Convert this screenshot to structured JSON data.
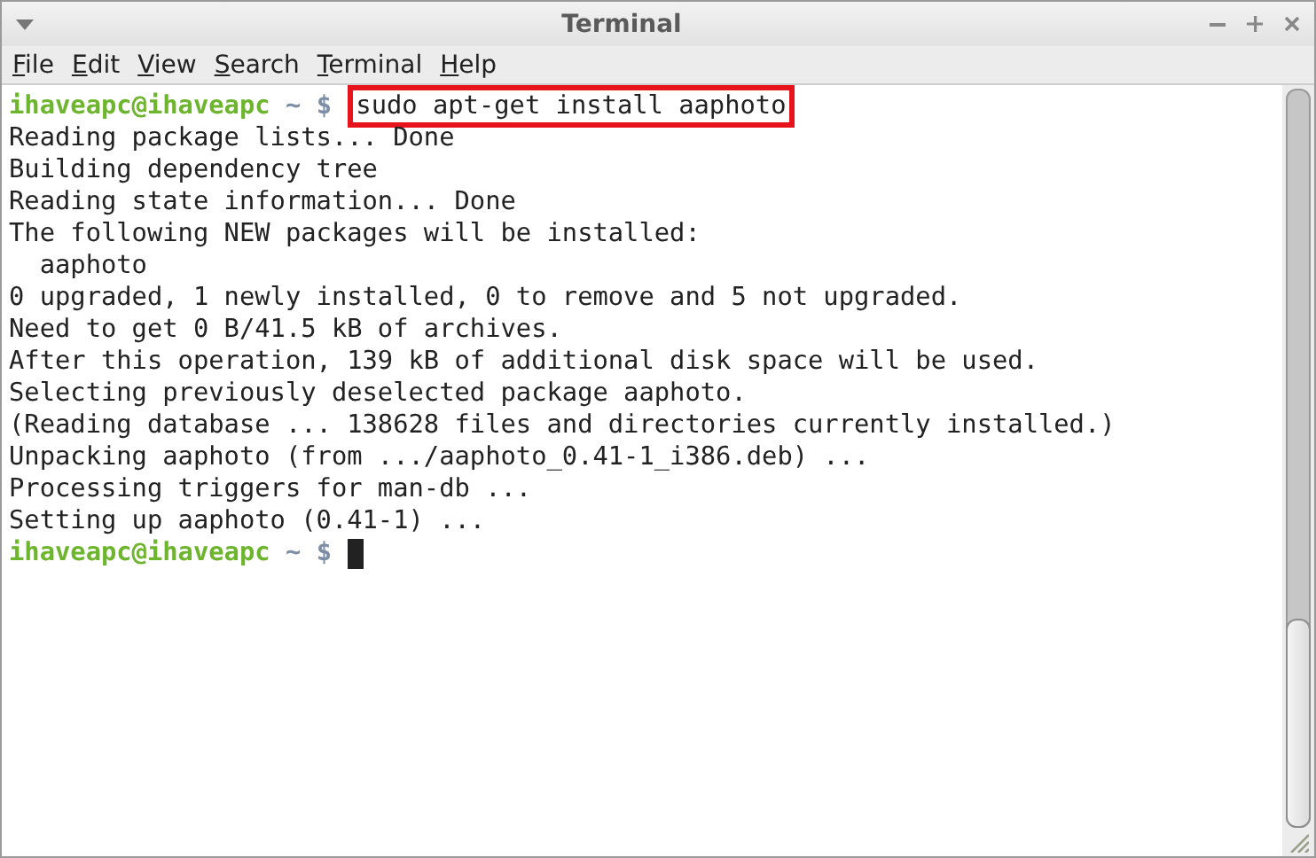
{
  "window": {
    "title": "Terminal"
  },
  "menu": [
    {
      "label": "File"
    },
    {
      "label": "Edit"
    },
    {
      "label": "View"
    },
    {
      "label": "Search"
    },
    {
      "label": "Terminal"
    },
    {
      "label": "Help"
    }
  ],
  "lines": [
    {
      "kind": "prompt",
      "user": "ihaveapc@ihaveapc",
      "path": "~",
      "symbol": "$",
      "command": "sudo apt-get install aaphoto",
      "highlighted": true,
      "cursor": false
    },
    {
      "kind": "output",
      "text": "Reading package lists... Done"
    },
    {
      "kind": "output",
      "text": "Building dependency tree"
    },
    {
      "kind": "output",
      "text": "Reading state information... Done"
    },
    {
      "kind": "output",
      "text": "The following NEW packages will be installed:"
    },
    {
      "kind": "output",
      "text": "  aaphoto"
    },
    {
      "kind": "output",
      "text": "0 upgraded, 1 newly installed, 0 to remove and 5 not upgraded."
    },
    {
      "kind": "output",
      "text": "Need to get 0 B/41.5 kB of archives."
    },
    {
      "kind": "output",
      "text": "After this operation, 139 kB of additional disk space will be used."
    },
    {
      "kind": "output",
      "text": "Selecting previously deselected package aaphoto."
    },
    {
      "kind": "output",
      "text": "(Reading database ... 138628 files and directories currently installed.)"
    },
    {
      "kind": "output",
      "text": "Unpacking aaphoto (from .../aaphoto_0.41-1_i386.deb) ..."
    },
    {
      "kind": "output",
      "text": "Processing triggers for man-db ..."
    },
    {
      "kind": "output",
      "text": "Setting up aaphoto (0.41-1) ..."
    },
    {
      "kind": "prompt",
      "user": "ihaveapc@ihaveapc",
      "path": "~",
      "symbol": "$",
      "cursor": true
    }
  ]
}
